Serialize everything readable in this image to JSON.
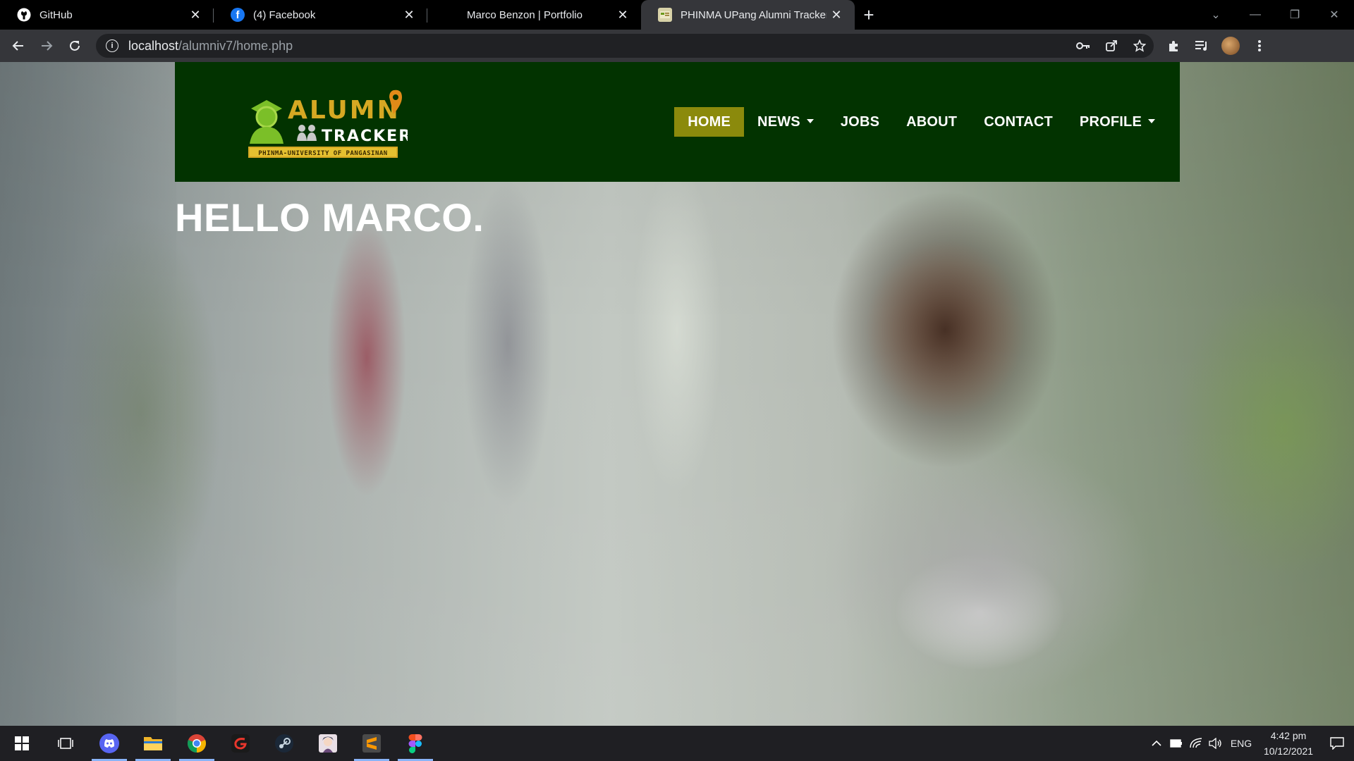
{
  "browser": {
    "tabs": [
      {
        "title": "GitHub",
        "icon": "github-icon"
      },
      {
        "title": "(4) Facebook",
        "icon": "facebook-icon"
      },
      {
        "title": "Marco Benzon | Portfolio",
        "icon": ""
      },
      {
        "title": "PHINMA UPang Alumni Tracker",
        "icon": "alumni-tracker-icon",
        "active": true
      }
    ],
    "url_host": "localhost",
    "url_path": "/alumniv7/home.php"
  },
  "site": {
    "logo": {
      "line1": "ALUMN",
      "line2": "TRACKER",
      "tagline": "PHINMA-UNIVERSITY OF PANGASINAN"
    },
    "nav": [
      {
        "label": "HOME",
        "active": true,
        "dropdown": false
      },
      {
        "label": "NEWS",
        "active": false,
        "dropdown": true
      },
      {
        "label": "JOBS",
        "active": false,
        "dropdown": false
      },
      {
        "label": "ABOUT",
        "active": false,
        "dropdown": false
      },
      {
        "label": "CONTACT",
        "active": false,
        "dropdown": false
      },
      {
        "label": "PROFILE",
        "active": false,
        "dropdown": true
      }
    ],
    "greeting": "HELLO MARCO.",
    "colors": {
      "nav_bg": "#023300",
      "active_bg": "#8b8a0c"
    }
  },
  "taskbar": {
    "apps": [
      "windows-start-icon",
      "task-view-icon",
      "discord-icon",
      "file-explorer-icon",
      "chrome-icon",
      "garena-icon",
      "steam-icon",
      "anime-app-icon",
      "sublime-text-icon",
      "figma-icon"
    ],
    "language": "ENG",
    "time": "4:42 pm",
    "date": "10/12/2021"
  }
}
